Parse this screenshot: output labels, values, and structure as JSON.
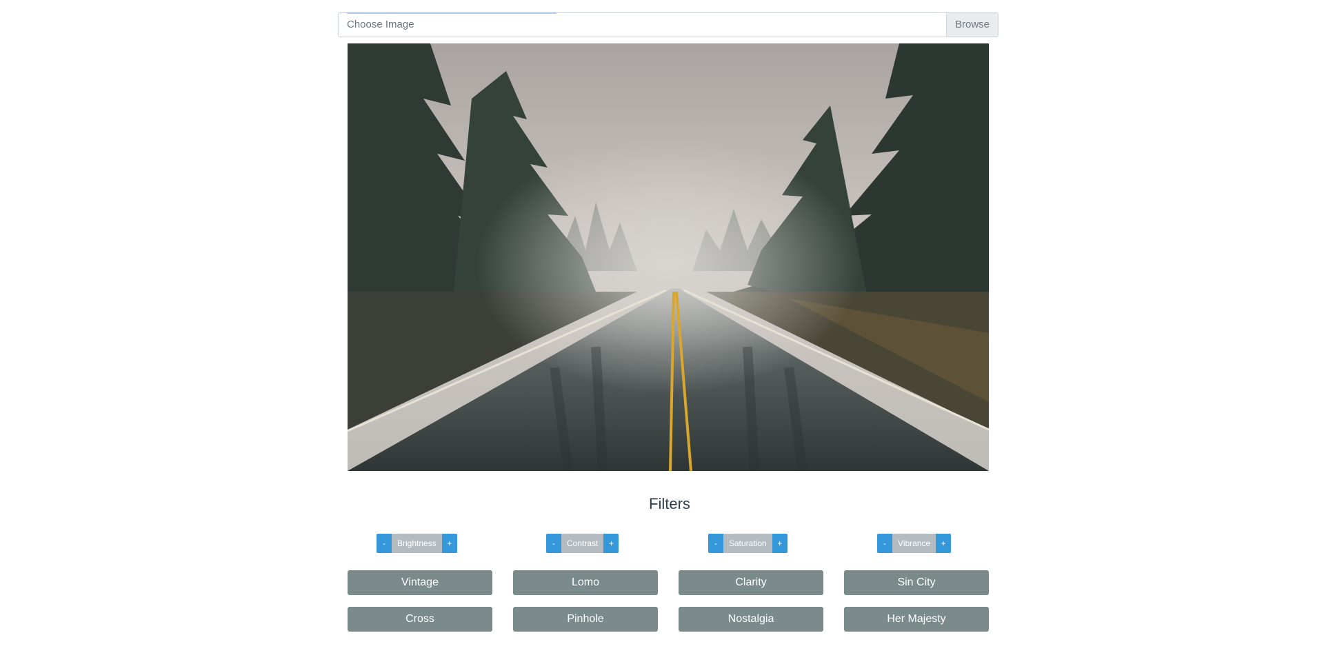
{
  "file_input": {
    "placeholder": "Choose Image",
    "browse_label": "Browse"
  },
  "image": {
    "icon": "rainy-forest-road-photo"
  },
  "filters": {
    "title": "Filters",
    "minus": "-",
    "plus": "+",
    "adjustments": [
      {
        "label": "Brightness"
      },
      {
        "label": "Contrast"
      },
      {
        "label": "Saturation"
      },
      {
        "label": "Vibrance"
      }
    ],
    "presets": [
      "Vintage",
      "Lomo",
      "Clarity",
      "Sin City",
      "Cross",
      "Pinhole",
      "Nostalgia",
      "Her Majesty"
    ]
  },
  "colors": {
    "primary": "#3498db",
    "adjust_label_bg": "#b4bcc2",
    "preset_bg": "#7b8a8b",
    "heading": "#2c3e50"
  }
}
